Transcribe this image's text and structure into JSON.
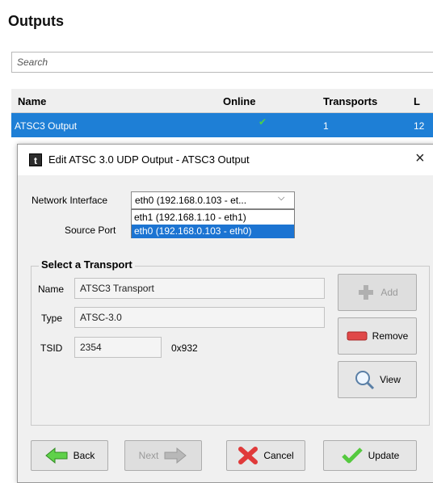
{
  "page": {
    "title": "Outputs",
    "search_placeholder": "Search",
    "table": {
      "headers": [
        "Name",
        "Online",
        "Transports",
        "L"
      ],
      "row": {
        "name": "ATSC3 Output",
        "online_icon": "check-icon",
        "transports": "1",
        "truncated": "12"
      }
    }
  },
  "dialog": {
    "title": "Edit ATSC 3.0 UDP Output - ATSC3 Output",
    "app_icon_glyph": "t",
    "close_glyph": "×",
    "network_interface_label": "Network Interface",
    "network_interface_value": "eth0 (192.168.0.103 - et...",
    "network_interface_options": [
      "eth1 (192.168.1.10 - eth1)",
      "eth0 (192.168.0.103 - eth0)"
    ],
    "source_port_label": "Source Port",
    "transport_group_title": "Select a Transport",
    "name_label": "Name",
    "name_value": "ATSC3 Transport",
    "type_label": "Type",
    "type_value": "ATSC-3.0",
    "tsid_label": "TSID",
    "tsid_value": "2354",
    "tsid_hex": "0x932",
    "buttons": {
      "add": "Add",
      "remove": "Remove",
      "view": "View",
      "back": "Back",
      "next": "Next",
      "cancel": "Cancel",
      "update": "Update"
    }
  },
  "colors": {
    "selection_blue": "#1e7fd6",
    "check_green": "#4bd04b",
    "remove_red": "#e04848",
    "add_gray": "#b0b0b0"
  }
}
